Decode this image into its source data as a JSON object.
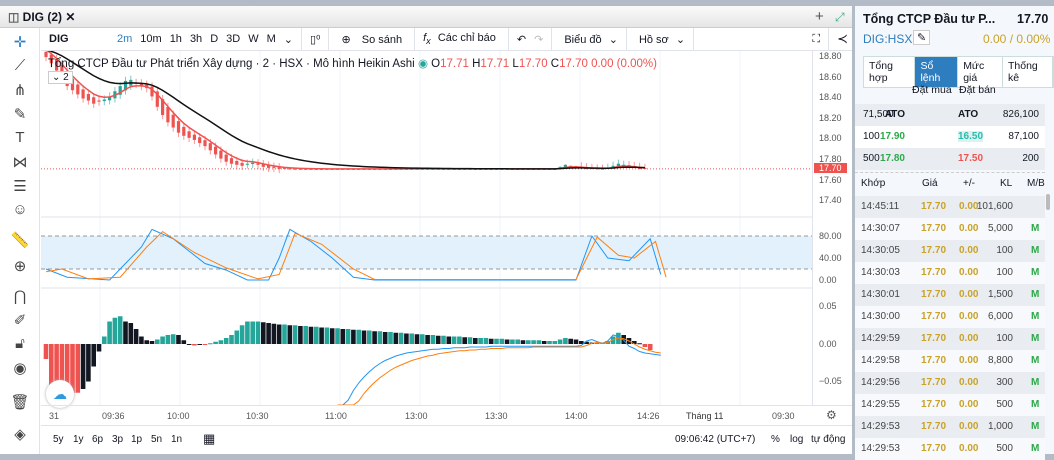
{
  "tab": {
    "title": "DIG (2)",
    "close": "✕",
    "plus": "+"
  },
  "toolbar": {
    "symbol": "DIG",
    "intervals": [
      "2m",
      "10m",
      "1h",
      "3h",
      "D",
      "3D",
      "W",
      "M"
    ],
    "compare": "So sánh",
    "indicators": "Các chỉ báo",
    "chart": "Biểu đồ",
    "profile": "Hồ sơ"
  },
  "legend": {
    "title": "Tổng CTCP Đầu tư Phát triển Xây dựng · 2 · HSX · Mô hình Heikin Ashi",
    "o_label": "O",
    "o": "17.71",
    "h_label": "H",
    "h": "17.71",
    "l_label": "L",
    "l": "17.70",
    "c_label": "C",
    "c": "17.70",
    "chg": "0.00 (0.00%)",
    "collapse": "2"
  },
  "price_scale": {
    "main": [
      "18.80",
      "18.60",
      "18.40",
      "18.20",
      "18.00",
      "17.80",
      "17.60",
      "17.40"
    ],
    "last": "17.70",
    "stoch": [
      "80.00",
      "40.00",
      "0.00"
    ],
    "macd": [
      "0.05",
      "0.00",
      "−0.05"
    ]
  },
  "time_axis": [
    "31",
    "09:36",
    "10:00",
    "10:30",
    "11:00",
    "13:00",
    "13:30",
    "14:00",
    "14:26",
    "Tháng 11",
    "09:30"
  ],
  "bottom": {
    "ranges": [
      "5y",
      "1y",
      "6p",
      "3p",
      "1p",
      "5n",
      "1n"
    ],
    "clock": "09:06:42 (UTC+7)",
    "pct": "%",
    "log": "log",
    "auto": "tự động"
  },
  "chart_data": {
    "type": "candlestick",
    "closes": [
      18.78,
      18.72,
      18.65,
      18.58,
      18.5,
      18.46,
      18.42,
      18.38,
      18.36,
      18.33,
      18.35,
      18.37,
      18.4,
      18.45,
      18.5,
      18.55,
      18.56,
      18.52,
      18.5,
      18.48,
      18.4,
      18.3,
      18.22,
      18.15,
      18.1,
      18.05,
      18.02,
      18,
      17.98,
      17.95,
      17.92,
      17.88,
      17.84,
      17.8,
      17.77,
      17.75,
      17.74,
      17.73,
      17.75,
      17.76,
      17.74,
      17.72,
      17.71,
      17.71,
      17.7,
      17.7,
      17.7,
      17.7,
      17.7,
      17.7,
      17.7,
      17.7,
      17.7,
      17.7,
      17.7,
      17.7,
      17.7,
      17.7,
      17.7,
      17.7,
      17.7,
      17.7,
      17.7,
      17.7,
      17.7,
      17.7,
      17.7,
      17.7,
      17.7,
      17.7,
      17.7,
      17.7,
      17.7,
      17.7,
      17.7,
      17.7,
      17.7,
      17.7,
      17.7,
      17.7,
      17.7,
      17.7,
      17.7,
      17.7,
      17.7,
      17.7,
      17.7,
      17.7,
      17.7,
      17.7,
      17.7,
      17.7,
      17.7,
      17.7,
      17.7,
      17.7,
      17.7,
      17.72,
      17.74,
      17.73,
      17.72,
      17.71,
      17.7,
      17.7,
      17.7,
      17.7,
      17.71,
      17.73,
      17.75,
      17.74,
      17.72,
      17.71,
      17.7,
      17.7
    ],
    "stoch_k": [
      [
        0,
        20
      ],
      [
        4,
        5
      ],
      [
        12,
        0
      ],
      [
        18,
        60
      ],
      [
        20,
        92
      ],
      [
        24,
        75
      ],
      [
        30,
        30
      ],
      [
        34,
        18
      ],
      [
        38,
        0
      ],
      [
        42,
        0
      ],
      [
        44,
        40
      ],
      [
        46,
        92
      ],
      [
        50,
        70
      ],
      [
        54,
        40
      ],
      [
        58,
        5
      ],
      [
        62,
        0
      ],
      [
        100,
        0
      ],
      [
        103,
        80
      ],
      [
        106,
        40
      ],
      [
        110,
        35
      ],
      [
        114,
        75
      ],
      [
        116,
        10
      ]
    ],
    "stoch_d": [
      [
        0,
        15
      ],
      [
        3,
        20
      ],
      [
        8,
        2
      ],
      [
        14,
        5
      ],
      [
        19,
        60
      ],
      [
        22,
        88
      ],
      [
        28,
        50
      ],
      [
        34,
        22
      ],
      [
        40,
        2
      ],
      [
        44,
        10
      ],
      [
        47,
        85
      ],
      [
        52,
        65
      ],
      [
        58,
        20
      ],
      [
        62,
        1
      ],
      [
        100,
        1
      ],
      [
        104,
        78
      ],
      [
        108,
        45
      ],
      [
        111,
        40
      ],
      [
        115,
        70
      ],
      [
        117,
        5
      ]
    ],
    "macd_hist": [
      -0.02,
      -0.06,
      -0.065,
      -0.065,
      -0.065,
      -0.065,
      -0.065,
      -0.06,
      -0.05,
      -0.03,
      -0.01,
      0.01,
      0.03,
      0.035,
      0.037,
      0.03,
      0.028,
      0.02,
      0.01,
      0.005,
      0.004,
      0.006,
      0.01,
      0.012,
      0.013,
      0.012,
      0.005,
      0,
      -0.002,
      -0.001,
      -0.001,
      0.001,
      0.003,
      0.005,
      0.008,
      0.012,
      0.018,
      0.025,
      0.03,
      0.03,
      0.03,
      0.029,
      0.028,
      0.027,
      0.026,
      0.026,
      0.025,
      0.025,
      0.024,
      0.024,
      0.023,
      0.023,
      0.022,
      0.022,
      0.021,
      0.021,
      0.02,
      0.02,
      0.019,
      0.019,
      0.018,
      0.018,
      0.017,
      0.017,
      0.016,
      0.016,
      0.015,
      0.015,
      0.014,
      0.014,
      0.013,
      0.013,
      0.012,
      0.012,
      0.011,
      0.011,
      0.01,
      0.01,
      0.01,
      0.009,
      0.009,
      0.008,
      0.008,
      0.008,
      0.007,
      0.007,
      0.007,
      0.006,
      0.006,
      0.006,
      0.005,
      0.005,
      0.005,
      0.005,
      0.004,
      0.004,
      0.004,
      0.006,
      0.008,
      0.007,
      0.006,
      0.004,
      0.003,
      0.002,
      0.002,
      0.002,
      0.004,
      0.01,
      0.015,
      0.012,
      0.008,
      0.004,
      0.001,
      -0.004,
      -0.008
    ],
    "macd_start": 55,
    "macd_line": [
      -0.11,
      -0.09,
      -0.075,
      -0.062,
      -0.052,
      -0.044,
      -0.037,
      -0.031,
      -0.026,
      -0.022,
      -0.019,
      -0.016,
      -0.014,
      -0.012,
      -0.011,
      -0.01,
      -0.009,
      -0.008,
      -0.007,
      -0.007,
      -0.006,
      -0.006,
      -0.005,
      -0.005,
      -0.005,
      -0.004,
      -0.004,
      -0.004,
      -0.004,
      -0.003,
      -0.003,
      -0.003,
      -0.003,
      -0.003,
      -0.003,
      -0.003,
      -0.003,
      -0.003,
      -0.003,
      -0.003,
      -0.003,
      -0.003,
      -0.003,
      -0.003,
      -0.003,
      -0.003,
      -0.002,
      0.004,
      0.006,
      0.003,
      0.001,
      0.004,
      0.012,
      0.01,
      0.005,
      -0.003,
      -0.006,
      -0.01,
      -0.012,
      -0.013,
      -0.014,
      -0.015
    ],
    "signal_line": [
      -0.13,
      -0.115,
      -0.1,
      -0.087,
      -0.076,
      -0.066,
      -0.058,
      -0.051,
      -0.045,
      -0.04,
      -0.035,
      -0.031,
      -0.028,
      -0.025,
      -0.022,
      -0.02,
      -0.018,
      -0.016,
      -0.015,
      -0.013,
      -0.012,
      -0.011,
      -0.01,
      -0.009,
      -0.009,
      -0.008,
      -0.008,
      -0.007,
      -0.007,
      -0.006,
      -0.006,
      -0.006,
      -0.005,
      -0.005,
      -0.005,
      -0.005,
      -0.005,
      -0.004,
      -0.004,
      -0.004,
      -0.004,
      -0.004,
      -0.004,
      -0.004,
      -0.004,
      -0.004,
      -0.004,
      -0.002,
      0.001,
      0.002,
      0.001,
      0.002,
      0.006,
      0.008,
      0.007,
      0.004,
      0.0,
      -0.004,
      -0.007,
      -0.009,
      -0.011,
      -0.012
    ],
    "ylim_main": [
      17.3,
      18.85
    ],
    "ylim_stoch": [
      0,
      100
    ],
    "ylim_macd": [
      -0.11,
      0.06
    ]
  },
  "panel": {
    "name": "Tổng CTCP Đầu tư P...",
    "price": "17.70",
    "ticker": "DIG:HSX",
    "change": "0.00 / 0.00%",
    "tabs": [
      "Tổng hợp",
      "Sổ lệnh",
      "Mức giá",
      "Thống kê"
    ],
    "book_headers": [
      "Đặt mua",
      "Đặt bán"
    ],
    "book": [
      [
        "71,500",
        "ATO",
        "ATO",
        "826,100"
      ],
      [
        "100",
        "17.90",
        "16.50",
        "87,100"
      ],
      [
        "500",
        "17.80",
        "17.50",
        "200"
      ]
    ],
    "trade_headers": [
      "Khớp",
      "Giá",
      "+/-",
      "KL",
      "M/B"
    ],
    "trades": [
      [
        "14:45:11",
        "17.70",
        "0.00",
        "101,600",
        ""
      ],
      [
        "14:30:07",
        "17.70",
        "0.00",
        "5,000",
        "M"
      ],
      [
        "14:30:05",
        "17.70",
        "0.00",
        "100",
        "M"
      ],
      [
        "14:30:03",
        "17.70",
        "0.00",
        "100",
        "M"
      ],
      [
        "14:30:01",
        "17.70",
        "0.00",
        "1,500",
        "M"
      ],
      [
        "14:30:00",
        "17.70",
        "0.00",
        "6,000",
        "M"
      ],
      [
        "14:29:59",
        "17.70",
        "0.00",
        "100",
        "M"
      ],
      [
        "14:29:58",
        "17.70",
        "0.00",
        "8,800",
        "M"
      ],
      [
        "14:29:56",
        "17.70",
        "0.00",
        "300",
        "M"
      ],
      [
        "14:29:55",
        "17.70",
        "0.00",
        "500",
        "M"
      ],
      [
        "14:29:53",
        "17.70",
        "0.00",
        "1,000",
        "M"
      ],
      [
        "14:29:53",
        "17.70",
        "0.00",
        "500",
        "M"
      ]
    ]
  },
  "colors": {
    "up": "#26a69a",
    "down": "#ef5350",
    "accent": "#2e7dbf",
    "gold": "#c9a227"
  }
}
